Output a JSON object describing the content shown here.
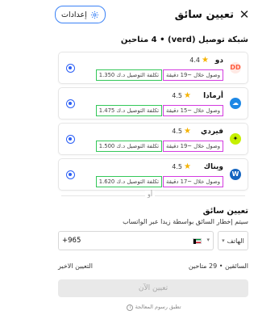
{
  "header": {
    "title": "تعيين سائق",
    "settings_label": "إعدادات",
    "close_glyph": "✕"
  },
  "network": {
    "heading": "شبكة توصيل (verd) • 4 متاحين"
  },
  "providers": [
    {
      "name": "دو",
      "rating": "4.4",
      "time": "وصول خلال ~19 دقيقة",
      "cost": "تكلفة التوصيل د.ك 1.350",
      "logo_text": "DD",
      "logo_color": "#ff5a3c",
      "logo_bg": "#ffe9e4"
    },
    {
      "name": "أرمادا",
      "rating": "4.5",
      "time": "وصول خلال ~15 دقيقة",
      "cost": "تكلفة التوصيل د.ك 1.475",
      "logo_text": "☁",
      "logo_color": "#ffffff",
      "logo_bg": "#1e88e5"
    },
    {
      "name": "فيردي",
      "rating": "4.5",
      "time": "وصول خلال ~19 دقيقة",
      "cost": "تكلفة التوصيل د.ك 1.500",
      "logo_text": "✦",
      "logo_color": "#1a1a1a",
      "logo_bg": "#c6f000"
    },
    {
      "name": "ويناك",
      "rating": "4.5",
      "time": "وصول خلال ~17 دقيقة",
      "cost": "تكلفة التوصيل د.ك 1.620",
      "logo_text": "W",
      "logo_color": "#ffffff",
      "logo_bg": "#1565c0"
    }
  ],
  "divider_label": "أو",
  "assign": {
    "title": "تعيين سائق",
    "description": "سيتم إخطار السائق بواسطة زيدا عبر الواتساب",
    "phone_type": "الهاتف",
    "country_code": "+965"
  },
  "stats": {
    "drivers": "السائقين • 29 متاحين",
    "last": "التعيين الاخير"
  },
  "assign_button": "تعيين الآن",
  "footer": "تطبق رسوم المعالجة",
  "colors": {
    "accent": "#2b5ff5",
    "time_highlight": "#d33be0",
    "cost_highlight": "#34c759",
    "star": "#f5b301"
  }
}
